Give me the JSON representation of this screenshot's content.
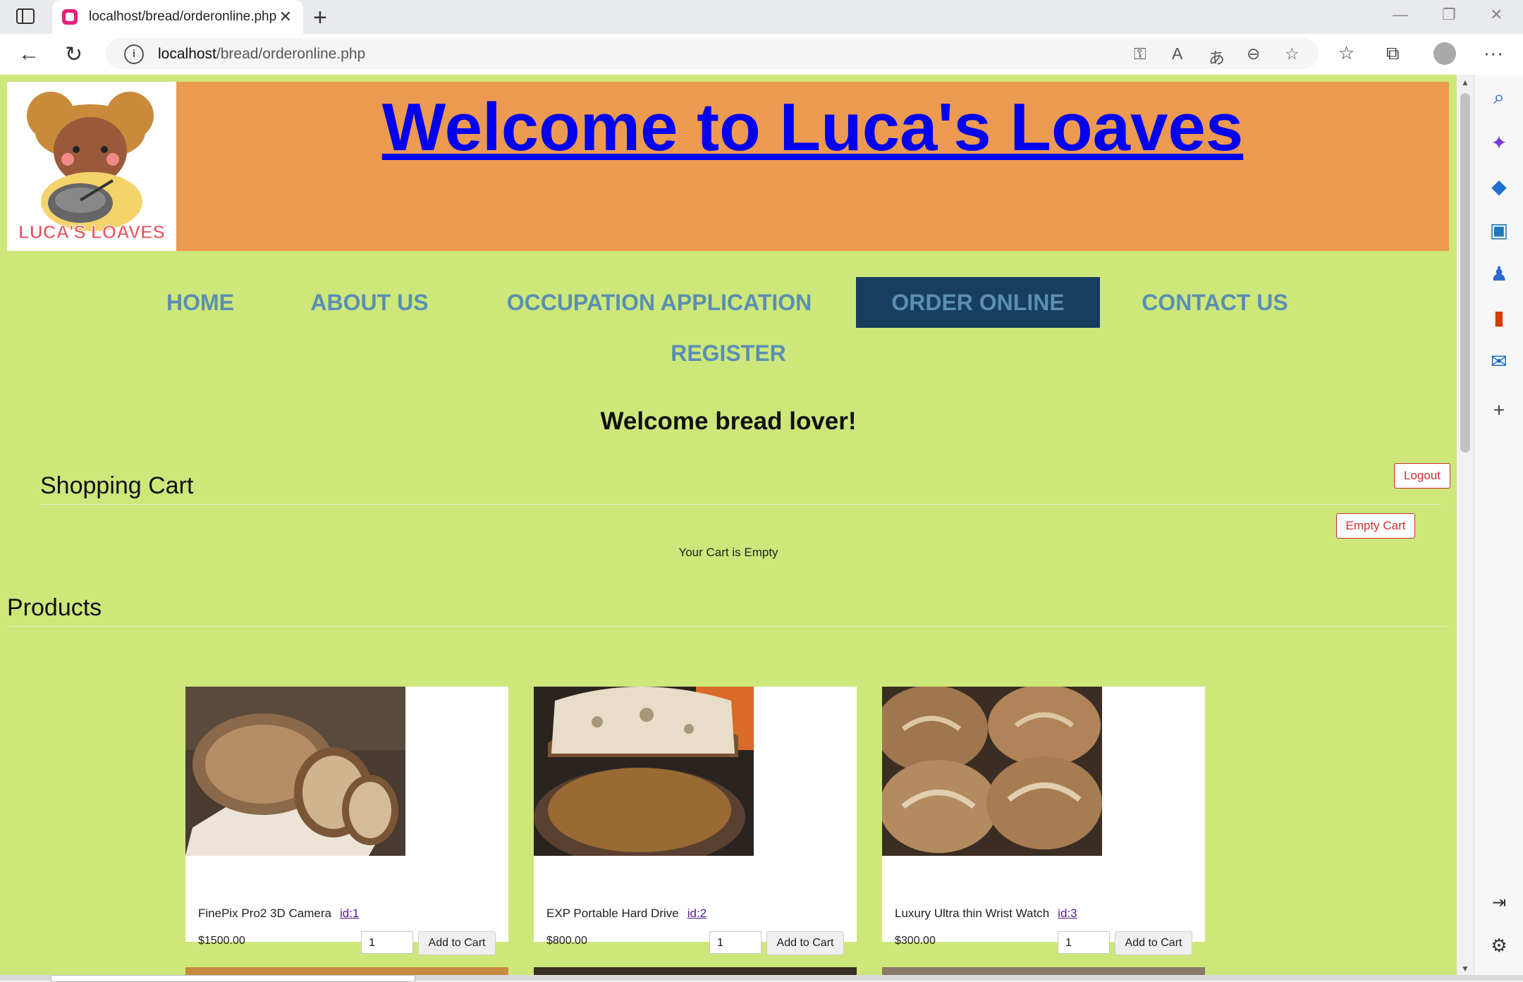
{
  "browser": {
    "tab_title": "localhost/bread/orderonline.php",
    "url_host": "localhost",
    "url_path": "/bread/orderonline.php",
    "new_tab": "+",
    "close": "✕"
  },
  "site": {
    "title": "Welcome to Luca's Loaves",
    "logo_text": "LUCA'S LOAVES",
    "accent_header": "#ec9a52",
    "page_bg": "#cde77a",
    "nav_active_bg": "#173e5e",
    "nav_text_color": "#5b8fb2"
  },
  "nav": [
    {
      "label": "HOME"
    },
    {
      "label": "ABOUT US"
    },
    {
      "label": "OCCUPATION APPLICATION"
    },
    {
      "label": "ORDER ONLINE",
      "active": true
    },
    {
      "label": "CONTACT US"
    },
    {
      "label": "REGISTER"
    }
  ],
  "welcome": "Welcome bread lover!",
  "cart": {
    "title": "Shopping Cart",
    "logout": "Logout",
    "empty_cart": "Empty Cart",
    "empty_message": "Your Cart is Empty"
  },
  "products": {
    "title": "Products",
    "add_label": "Add to Cart",
    "items": [
      {
        "name": "FinePix Pro2 3D Camera",
        "id": "id:1",
        "price": "$1500.00",
        "qty": "1"
      },
      {
        "name": "EXP Portable Hard Drive",
        "id": "id:2",
        "price": "$800.00",
        "qty": "1"
      },
      {
        "name": "Luxury Ultra thin Wrist Watch",
        "id": "id:3",
        "price": "$300.00",
        "qty": "1"
      }
    ]
  },
  "icons": [
    "tab-actions-icon",
    "back-icon",
    "refresh-icon",
    "info-icon",
    "key-icon",
    "read-aloud-icon",
    "translate-icon",
    "zoom-out-icon",
    "favorite-add-icon",
    "favorites-icon",
    "collections-icon",
    "profile-icon",
    "more-icon",
    "search-icon",
    "copilot-icon",
    "shopping-icon",
    "tools-icon",
    "games-icon",
    "office-icon",
    "outlook-icon",
    "add-icon",
    "sidebar-hide-icon",
    "settings-icon"
  ]
}
